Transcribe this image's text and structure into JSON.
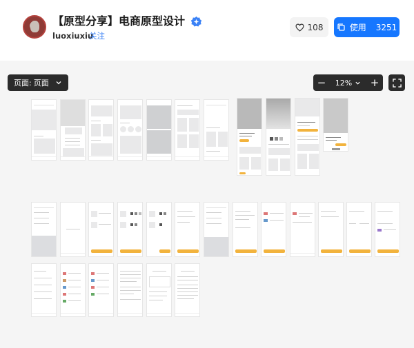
{
  "header": {
    "title": "【原型分享】电商原型设计",
    "author": "luoxiuxiu",
    "follow_label": "关注",
    "verified_icon": "verified-badge-icon",
    "like_count": "108",
    "use_label": "使用",
    "use_count": "3251"
  },
  "toolbar": {
    "page_prefix": "页面:",
    "page_value": "页面",
    "zoom_minus": "−",
    "zoom_value": "12%",
    "zoom_plus": "+"
  },
  "colors": {
    "primary": "#1677ff",
    "accent_yellow": "#f2b33d",
    "canvas_bg": "#f5f5f5",
    "toolbar_dark": "#2b2b2b"
  }
}
